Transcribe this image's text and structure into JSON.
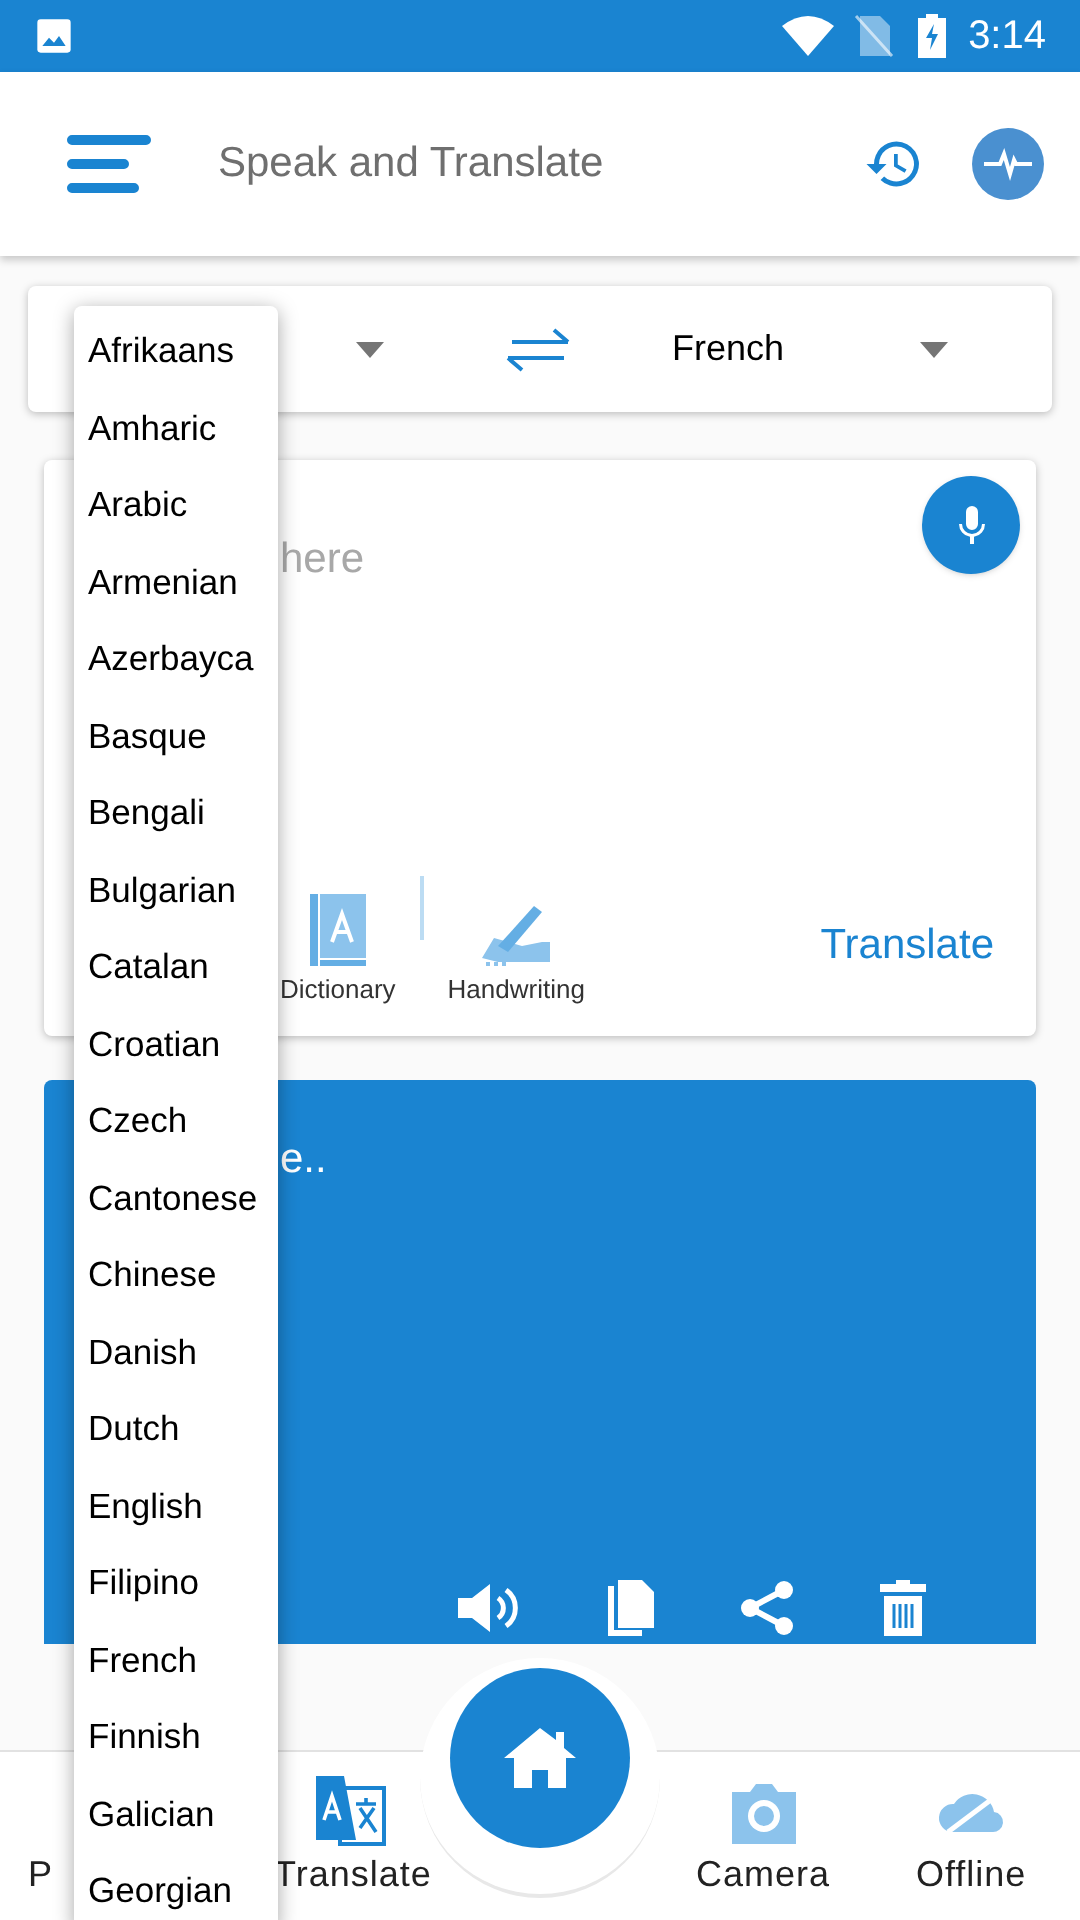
{
  "status_bar": {
    "time": "3:14"
  },
  "app_bar": {
    "title": "Speak and Translate"
  },
  "language_bar": {
    "target": "French"
  },
  "input_card": {
    "placeholder": "here",
    "tools": [
      {
        "kind": "dictionary",
        "label": "Dictionary"
      },
      {
        "kind": "handwriting",
        "label": "Handwriting"
      }
    ],
    "action": "Translate"
  },
  "output_card": {
    "placeholder": "e.."
  },
  "bottom_nav": {
    "items": [
      {
        "kind": "hidden",
        "label": "P"
      },
      {
        "kind": "translate",
        "label": "Translate"
      },
      {
        "kind": "camera",
        "label": "Camera"
      },
      {
        "kind": "offline",
        "label": "Offline"
      }
    ]
  },
  "language_menu": {
    "items": [
      "Afrikaans",
      "Amharic",
      "Arabic",
      "Armenian",
      "Azerbayca",
      "Basque",
      "Bengali",
      "Bulgarian",
      "Catalan",
      "Croatian",
      "Czech",
      "Cantonese",
      "Chinese",
      "Danish",
      "Dutch",
      "English",
      "Filipino",
      "French",
      "Finnish",
      "Galician",
      "Georgian"
    ]
  }
}
